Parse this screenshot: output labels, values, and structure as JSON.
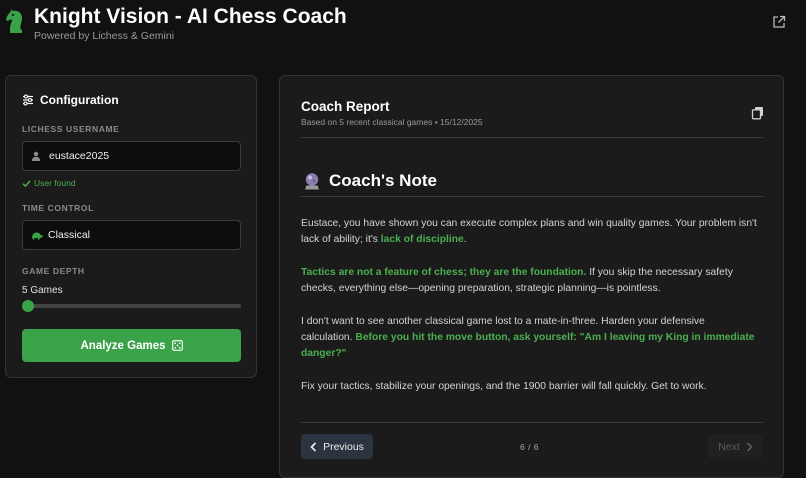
{
  "header": {
    "title": "Knight Vision - AI Chess Coach",
    "subtitle": "Powered by Lichess & Gemini",
    "logo_icon": "knight-icon",
    "external_icon": "external-link-icon"
  },
  "config": {
    "title": "Configuration",
    "title_icon": "sliders-icon",
    "username": {
      "label": "LICHESS USERNAME",
      "value": "eustace2025",
      "icon": "user-icon",
      "status": "User found",
      "status_icon": "check-icon"
    },
    "time_control": {
      "label": "TIME CONTROL",
      "value": "Classical",
      "icon": "turtle-icon"
    },
    "game_depth": {
      "label": "GAME DEPTH",
      "value_text": "5 Games",
      "value": 5
    },
    "analyze_label": "Analyze Games",
    "analyze_icon": "dice-icon"
  },
  "report": {
    "title": "Coach Report",
    "meta": "Based on 5 recent classical games • 15/12/2025",
    "copy_icon": "copy-icon",
    "note_heading": "Coach's Note",
    "note_icon": "crystal-ball-icon",
    "paragraphs": [
      {
        "before": "Eustace, you have shown you can execute complex plans and win quality games. Your problem isn't lack of ability; it's ",
        "highlight": "lack of discipline",
        "after": "."
      },
      {
        "highlight": "Tactics are not a feature of chess; they are the foundation.",
        "after": " If you skip the necessary safety checks, everything else—opening preparation, strategic planning—is pointless."
      },
      {
        "before": "I don't want to see another classical game lost to a mate-in-three. Harden your defensive calculation. ",
        "highlight": "Before you hit the move button, ask yourself: \"Am I leaving my King in immediate danger?\""
      },
      {
        "before": "Fix your tactics, stabilize your openings, and the 1900 barrier will fall quickly. Get to work."
      }
    ],
    "pagination": {
      "previous_label": "Previous",
      "next_label": "Next",
      "page_text": "6 / 6",
      "current": 6,
      "total": 6
    }
  },
  "colors": {
    "accent": "#3aa349",
    "highlight_text": "#4caf50",
    "background": "#111111",
    "panel": "#1b1b1b"
  }
}
